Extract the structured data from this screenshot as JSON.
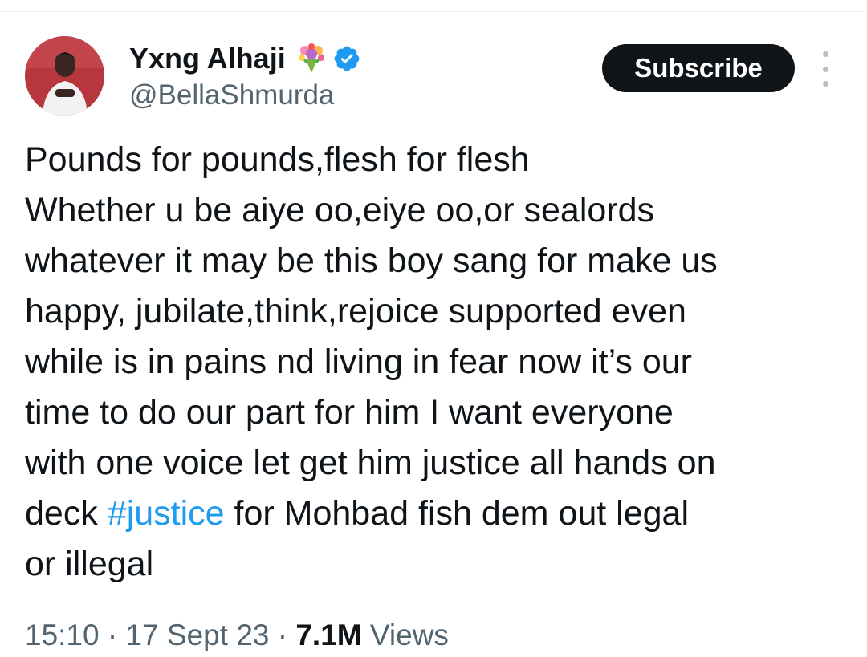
{
  "author": {
    "display_name": "Yxng Alhaji",
    "handle": "@BellaShmurda",
    "emoji_icon": "bouquet-icon",
    "verified_icon": "verified-badge-icon",
    "avatar_description_icon": "avatar-photo"
  },
  "actions": {
    "subscribe_label": "Subscribe",
    "more_icon": "more-options-icon"
  },
  "tweet": {
    "lines": [
      "Pounds for pounds,flesh for flesh",
      "Whether u be aiye oo,eiye oo,or sealords",
      "whatever it may be this boy sang for make us",
      "happy, jubilate,think,rejoice supported even",
      "while is in pains nd living in fear now it’s our",
      "time to do our part for him I want everyone",
      "with one voice let get him justice all hands on"
    ],
    "line8_before": "deck ",
    "hashtag": "#justice",
    "line8_after": " for Mohbad fish dem out legal",
    "line9": "or illegal"
  },
  "meta": {
    "time": "15:10",
    "separator": "·",
    "date": "17 Sept 23",
    "views_count": "7.1M",
    "views_label": "Views"
  },
  "colors": {
    "text": "#0f1419",
    "secondary": "#536471",
    "link": "#1d9bf0",
    "subscribe_bg": "#0f1419",
    "verified": "#1d9bf0"
  }
}
